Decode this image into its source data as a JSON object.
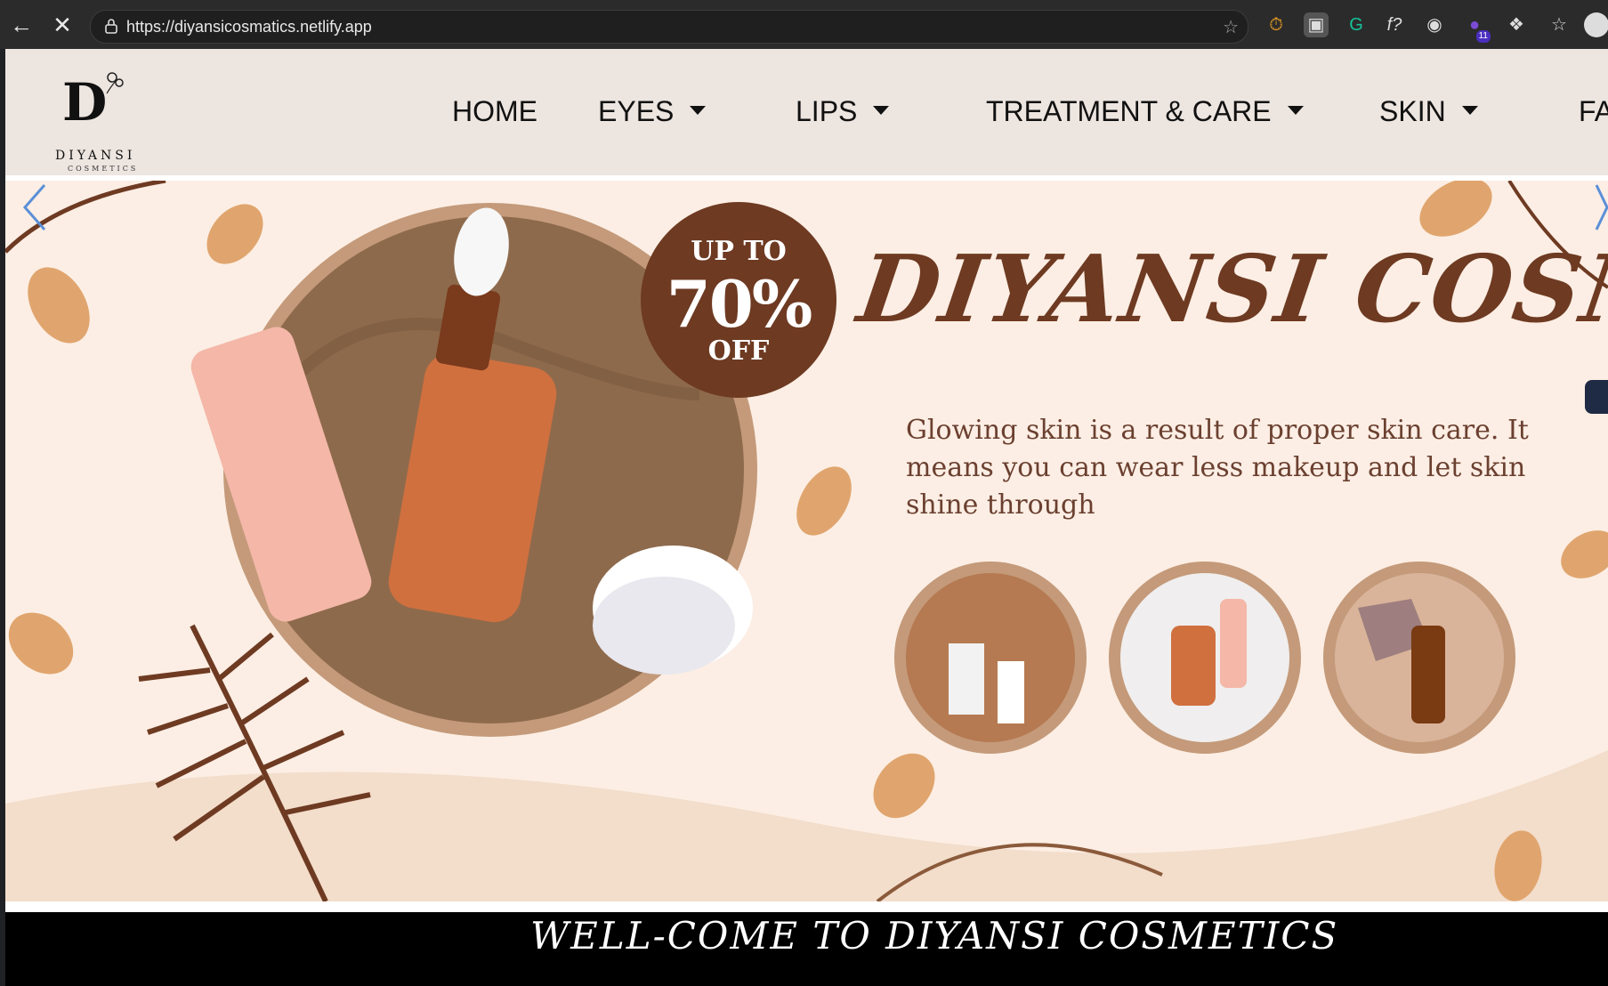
{
  "browser": {
    "url": "https://diyansicosmatics.netlify.app",
    "back_icon": "back-arrow-icon",
    "stop_icon": "close-icon",
    "extension_badge": "11"
  },
  "logo": {
    "monogram": "D",
    "brand": "DIYANSI",
    "sub": "COSMETICS"
  },
  "nav": {
    "items": [
      {
        "label": "HOME",
        "dropdown": false
      },
      {
        "label": "EYES",
        "dropdown": true
      },
      {
        "label": "LIPS",
        "dropdown": true
      },
      {
        "label": "TREATMENT & CARE",
        "dropdown": true
      },
      {
        "label": "SKIN",
        "dropdown": true
      },
      {
        "label": "FA",
        "dropdown": false
      }
    ]
  },
  "hero": {
    "promo": {
      "line1": "UP TO",
      "line2": "70%",
      "line3": "OFF"
    },
    "title": "DIYANSI COSMATIC",
    "tagline": "Glowing skin is a result of proper skin care. It means you can wear less makeup and let skin shine through",
    "carousel": {
      "slides": 4,
      "active": 1
    },
    "colors": {
      "background": "#fceee4",
      "accent_brown": "#6e3a22",
      "leaf": "#e0a56e"
    }
  },
  "welcome": {
    "text": "WELL-COME TO DIYANSI COSMETICS"
  }
}
